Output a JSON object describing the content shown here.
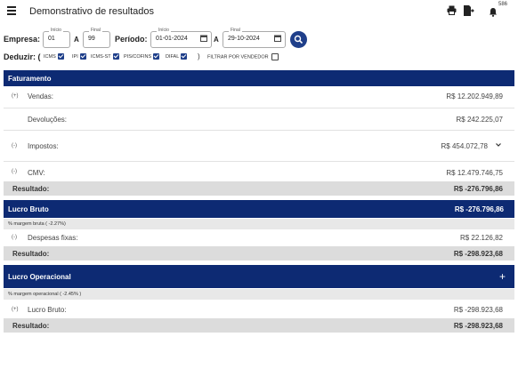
{
  "header": {
    "title": "Demonstrativo de resultados",
    "badge": "586"
  },
  "filters": {
    "empresa_label": "Empresa:",
    "empresa_inicio_caption": "Início",
    "empresa_inicio": "01",
    "a_label": "A",
    "empresa_final_caption": "Final",
    "empresa_final": "99",
    "periodo_label": "Período:",
    "periodo_inicio_caption": "Início",
    "periodo_inicio": "01-01-2024",
    "periodo_final_caption": "Final",
    "periodo_final": "29-10-2024"
  },
  "deduzir": {
    "label": "Deduzir: (",
    "items": [
      {
        "label": "ICMS",
        "checked": true
      },
      {
        "label": "IPI",
        "checked": true
      },
      {
        "label": "ICMS-ST",
        "checked": true
      },
      {
        "label": "PIS/COFINS",
        "checked": true
      },
      {
        "label": "DIFAL",
        "checked": true
      }
    ],
    "close": ")",
    "vendedor_label": "FILTRAR POR VENDEDOR",
    "vendedor_checked": false
  },
  "faturamento": {
    "title": "Faturamento",
    "vendas_sign": "(+)",
    "vendas_label": "Vendas:",
    "vendas_value": "R$ 12.202.949,89",
    "devolucoes_label": "Devoluções:",
    "devolucoes_value": "R$ 242.225,07",
    "impostos_sign": "(-)",
    "impostos_label": "Impostos:",
    "impostos_value": "R$ 454.072,78",
    "cmv_sign": "(-)",
    "cmv_label": "CMV:",
    "cmv_value": "R$ 12.479.746,75",
    "resultado_label": "Resultado:",
    "resultado_value": "R$ -276.796,86"
  },
  "lucro_bruto": {
    "title": "Lucro Bruto",
    "value": "R$ -276.796,86",
    "margem": "% margem bruta ( -2.27%)",
    "despesas_sign": "(-)",
    "despesas_label": "Despesas fixas:",
    "despesas_value": "R$ 22.126,82",
    "resultado_label": "Resultado:",
    "resultado_value": "R$ -298.923,68"
  },
  "lucro_operacional": {
    "title": "Lucro Operacional",
    "expand": "+",
    "margem": "% margem operacional ( -2.45% )",
    "lucro_bruto_sign": "(+)",
    "lucro_bruto_label": "Lucro Bruto:",
    "lucro_bruto_value": "R$ -298.923,68",
    "resultado_label": "Resultado:",
    "resultado_value": "R$ -298.923,68"
  },
  "colors": {
    "primary": "#0d2a73",
    "accent": "#1f3f8a",
    "result_bg": "#dcdcdc"
  },
  "icons": [
    "menu-icon",
    "printer-icon",
    "file-export-icon",
    "bell-icon",
    "calendar-icon",
    "search-icon",
    "chevron-down-icon",
    "plus-icon"
  ]
}
